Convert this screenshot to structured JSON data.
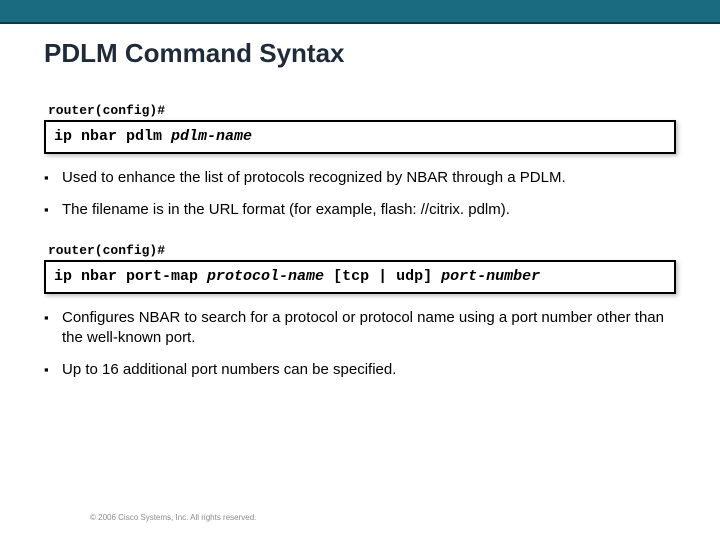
{
  "title": "PDLM Command Syntax",
  "block1": {
    "prompt": "router(config)#",
    "cmd_static": "ip nbar pdlm ",
    "cmd_var": "pdlm-name",
    "bullets": [
      "Used to enhance the list of protocols recognized by NBAR through a PDLM.",
      "The filename is in the URL format (for example, flash: //citrix. pdlm)."
    ]
  },
  "block2": {
    "prompt": "router(config)#",
    "cmd_static1": "ip nbar port-map ",
    "cmd_var1": "protocol-name",
    "cmd_static2": " [tcp | udp] ",
    "cmd_var2": "port-number",
    "bullets": [
      "Configures NBAR to search for a protocol or protocol name using a port number other than the well-known port.",
      "Up to 16 additional port numbers can be specified."
    ]
  },
  "footer": "© 2006 Cisco Systems, Inc. All rights reserved."
}
